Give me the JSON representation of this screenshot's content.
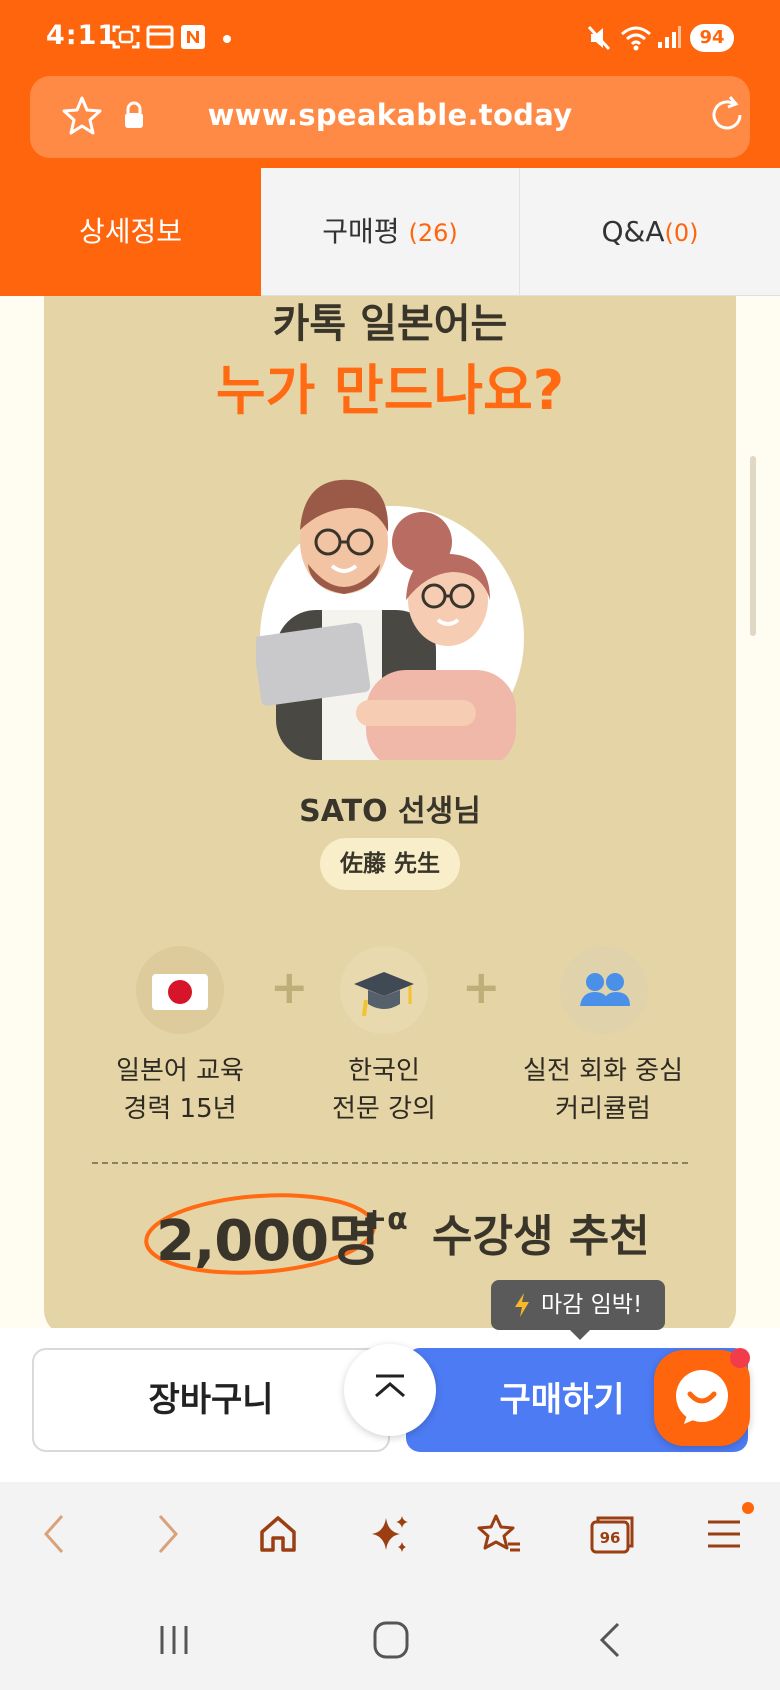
{
  "status_bar": {
    "time": "4:11",
    "battery": "94"
  },
  "browser": {
    "url": "www.speakable.today"
  },
  "tabs": [
    {
      "label": "상세정보",
      "count": ""
    },
    {
      "label": "구매평",
      "count": "(26)"
    },
    {
      "label": "Q&A",
      "count": "(0)"
    }
  ],
  "content": {
    "heading_line1": "카톡 일본어는",
    "heading_line2": "누가 만드나요?",
    "teacher_name": "SATO 선생님",
    "teacher_name_jp": "佐藤 先生",
    "features": [
      {
        "icon": "japan-flag-icon",
        "label": "일본어 교육\n경력 15년"
      },
      {
        "icon": "graduation-cap-icon",
        "label": "한국인\n전문 강의"
      },
      {
        "icon": "people-icon",
        "label": "실전 회화 중심\n커리큘럼"
      }
    ],
    "plus_sign": "+",
    "stat_number": "2,000명",
    "stat_alpha": "+α",
    "stat_text": "수강생 추천"
  },
  "actions": {
    "cart_label": "장바구니",
    "buy_label": "구매하기",
    "tooltip": "마감 임박!"
  },
  "colors": {
    "brand_orange": "#FF650D",
    "card_beige": "#E5D5A6",
    "buy_blue": "#4D7BF3"
  }
}
